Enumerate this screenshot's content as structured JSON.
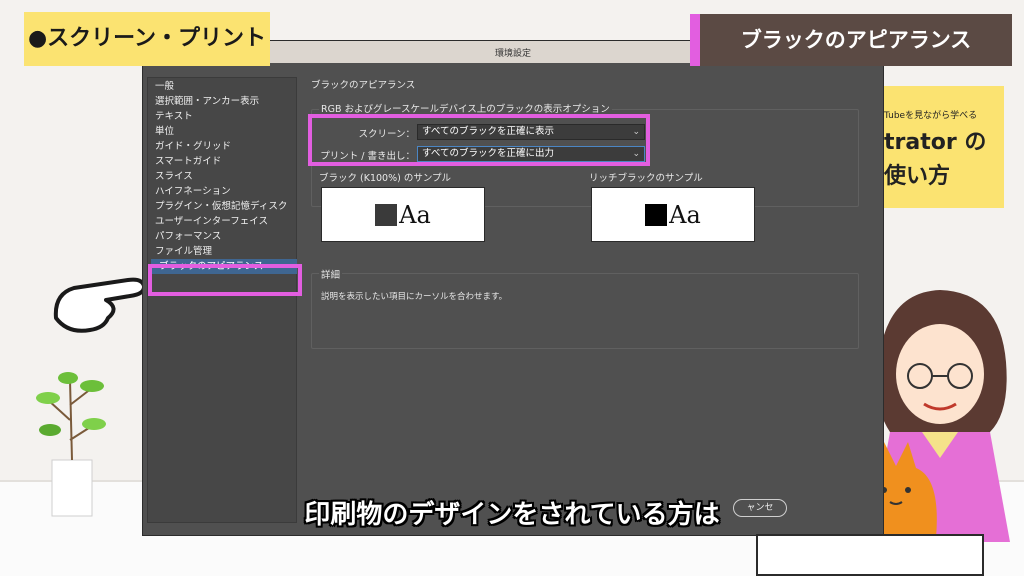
{
  "labels": {
    "left": "●スクリーン・プリント",
    "right": "ブラックのアピアランス"
  },
  "dialog": {
    "title": "環境設定",
    "sidebar_items": [
      "一般",
      "選択範囲・アンカー表示",
      "テキスト",
      "単位",
      "ガイド・グリッド",
      "スマートガイド",
      "スライス",
      "ハイフネーション",
      "プラグイン・仮想記憶ディスク",
      "ユーザーインターフェイス",
      "パフォーマンス",
      "ファイル管理",
      "ブラックのアピアランス"
    ],
    "selected_index": 12,
    "panel_title": "ブラックのアピアランス",
    "group_legend": "RGB およびグレースケールデバイス上のブラックの表示オプション",
    "screen_label": "スクリーン：",
    "screen_value": "すべてのブラックを正確に表示",
    "print_label": "プリント / 書き出し：",
    "print_value": "すべてのブラックを正確に出力",
    "sample1_label": "ブラック (K100%) のサンプル",
    "sample2_label": "リッチブラックのサンプル",
    "sample_text": "Aa",
    "sample1_swatch": "#3a3a3a",
    "sample2_swatch": "#000000",
    "detail_legend": "詳細",
    "detail_text": "説明を表示したい項目にカーソルを合わせます。",
    "cancel_partial": "ャンセ"
  },
  "book": {
    "line_small": "Tubeを見ながら学べる",
    "line_big1": "trator の",
    "line_big2": "使い方"
  },
  "caption": "印刷物のデザインをされている方は",
  "colors": {
    "highlight": "#e25ee0",
    "label_left_bg": "#fbe371",
    "label_right_bg": "#5b4a44",
    "selection": "#3f6691"
  }
}
